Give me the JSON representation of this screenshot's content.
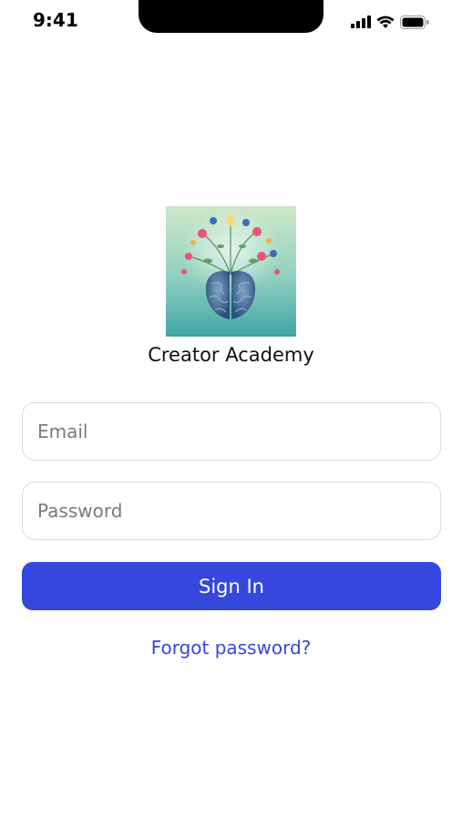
{
  "status_bar": {
    "time": "9:41",
    "icons": [
      "signal-icon",
      "wifi-icon",
      "battery-icon"
    ]
  },
  "app": {
    "logo_icon": "brain-with-flowers-logo",
    "name": "Creator Academy"
  },
  "form": {
    "email_placeholder": "Email",
    "email_value": "",
    "password_placeholder": "Password",
    "password_value": "",
    "sign_in_label": "Sign In",
    "forgot_password_label": "Forgot password?"
  },
  "colors": {
    "accent": "#3547dd",
    "input_border": "#dcdcdc",
    "logo_bg_top": "#cfe8c8",
    "logo_bg_bottom": "#3fa6a6"
  }
}
